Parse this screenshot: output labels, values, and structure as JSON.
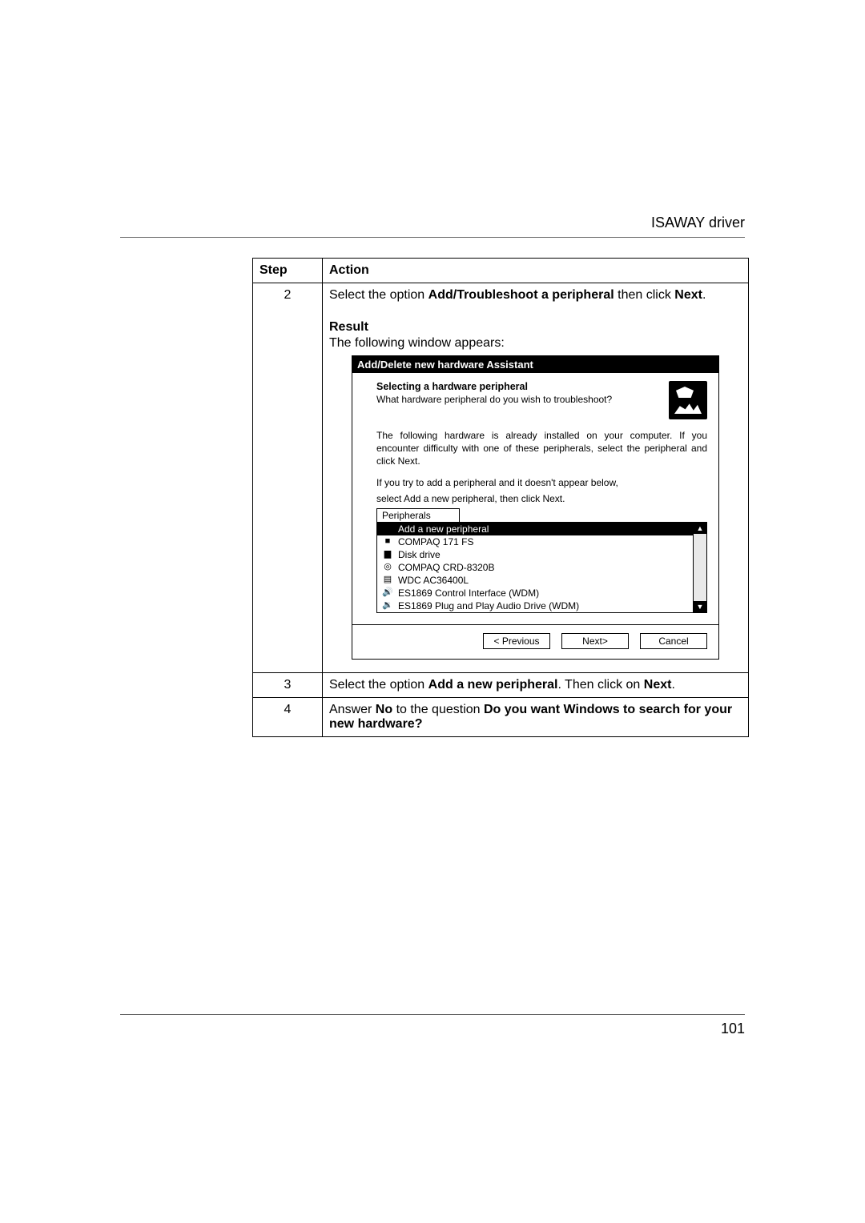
{
  "header": {
    "right": "ISAWAY driver"
  },
  "table": {
    "headers": {
      "step": "Step",
      "action": "Action"
    },
    "row2": {
      "num": "2",
      "line1_a": "Select the option ",
      "line1_b": "Add/Troubleshoot a peripheral",
      "line1_c": " then click ",
      "line1_d": "Next",
      "line1_e": ".",
      "result_label": "Result",
      "result_text": "The following window appears:"
    },
    "row3": {
      "num": "3",
      "a": "Select the option ",
      "b": "Add a new peripheral",
      "c": ". Then click on ",
      "d": "Next",
      "e": "."
    },
    "row4": {
      "num": "4",
      "a": "Answer ",
      "b": "No",
      "c": " to the question ",
      "d": "Do you want Windows to search for your new hardware?"
    }
  },
  "dialog": {
    "title": "Add/Delete new hardware Assistant",
    "subtitle": "Selecting a hardware peripheral",
    "question": "What hardware peripheral do you wish to troubleshoot?",
    "para1": "The following hardware is already installed on your computer. If you encounter difficulty with one of these peripherals, select the peripheral and click Next.",
    "para2a": "If you try to add a peripheral and it doesn't appear below,",
    "para2b": "select Add a new peripheral, then click Next.",
    "list_caption": "Peripherals",
    "items": [
      {
        "label": "Add a new peripheral",
        "icon": "",
        "selected": true
      },
      {
        "label": "COMPAQ 171 FS",
        "icon": "ico-monitor",
        "selected": false
      },
      {
        "label": "Disk drive",
        "icon": "ico-disk",
        "selected": false
      },
      {
        "label": "COMPAQ CRD-8320B",
        "icon": "ico-cd",
        "selected": false
      },
      {
        "label": "WDC AC36400L",
        "icon": "ico-hdd",
        "selected": false
      },
      {
        "label": "ES1869 Control Interface (WDM)",
        "icon": "ico-speaker1",
        "selected": false
      },
      {
        "label": "ES1869 Plug and Play Audio Drive (WDM)",
        "icon": "ico-speaker2",
        "selected": false
      }
    ],
    "scroll_up": "▲",
    "scroll_down": "▼",
    "buttons": {
      "prev": "< Previous",
      "next": "Next>",
      "cancel": "Cancel"
    }
  },
  "page_number": "101"
}
